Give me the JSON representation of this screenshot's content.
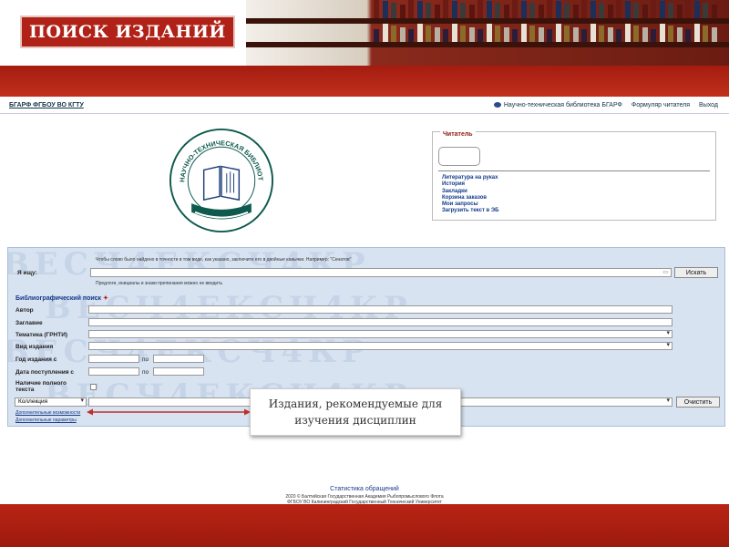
{
  "slide_title": "ПОИСК ИЗДАНИЙ",
  "topnav": {
    "brand": "БГАРФ ФГБОУ ВО КГТУ",
    "links": [
      "Научно-техническая библиотека БГАРФ",
      "Формуляр читателя",
      "Выход"
    ]
  },
  "reader": {
    "legend": "Читатель",
    "links": [
      "Литература на руках",
      "История",
      "Закладки",
      "Корзина заказов",
      "Мои запросы",
      "Загрузить текст в ЭБ"
    ]
  },
  "search": {
    "hint_top": "Чтобы слово было найдено в точности в том виде, как указано, заключите его в двойные кавычки. Например: \"Сенатов\"",
    "query_label": "Я ищу:",
    "query_value": "",
    "search_button": "Искать",
    "hint_bottom": "Предлоги, инициалы и знаки препинания можно не вводить",
    "bib_heading": "Библиографический поиск",
    "fields": {
      "author": "Автор",
      "title": "Заглавие",
      "topic": "Тематика (ГРНТИ)",
      "edition_type": "Вид издания",
      "year": "Год издания с",
      "arrival": "Дата поступления с",
      "to": "по",
      "fulltext": "Наличие полного текста"
    },
    "collection_select": "Коллекция",
    "clear_button": "Очистить",
    "link_extra": "Дополнительные возможности",
    "link_params": "Дополнительные параметры",
    "watermark": "ВЕСЧ4ЕКСЧ4КР"
  },
  "callout": "Издания, рекомендуемые для изучения дисциплин",
  "footer": {
    "stats": "Статистика обращений",
    "copy1": "2020 © Балтийская Государственная Академия Рыбопромыслового Флота",
    "copy2": "ФГБОУ ВО Калининградский Государственный Технический Университет"
  },
  "logo_text": "НАУЧНО-ТЕХНИЧЕСКАЯ БИБЛИОТЕКА БГАРФ",
  "colors": {
    "accent_red": "#b02117",
    "panel_blue": "#d8e3f1",
    "link_blue": "#1a3b8b"
  }
}
